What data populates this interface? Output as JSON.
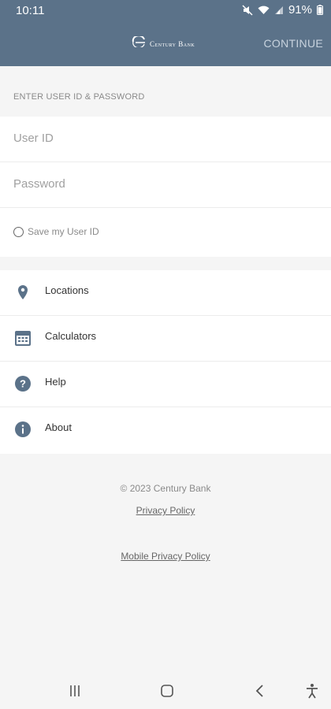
{
  "status_bar": {
    "time": "10:11",
    "battery": "91%"
  },
  "app_bar": {
    "logo_text": "Century Bank",
    "continue_label": "CONTINUE"
  },
  "login": {
    "section_header": "ENTER USER ID & PASSWORD",
    "user_id_placeholder": "User ID",
    "password_placeholder": "Password",
    "save_label": "Save my User ID"
  },
  "menu": {
    "items": [
      {
        "label": "Locations",
        "icon": "location-pin-icon"
      },
      {
        "label": "Calculators",
        "icon": "calculator-icon"
      },
      {
        "label": "Help",
        "icon": "help-icon"
      },
      {
        "label": "About",
        "icon": "info-icon"
      }
    ]
  },
  "footer": {
    "copyright": "© 2023 Century Bank",
    "privacy_policy": "Privacy Policy",
    "mobile_privacy_policy": "Mobile Privacy Policy"
  },
  "colors": {
    "primary": "#5b7289",
    "background": "#f5f5f5"
  }
}
